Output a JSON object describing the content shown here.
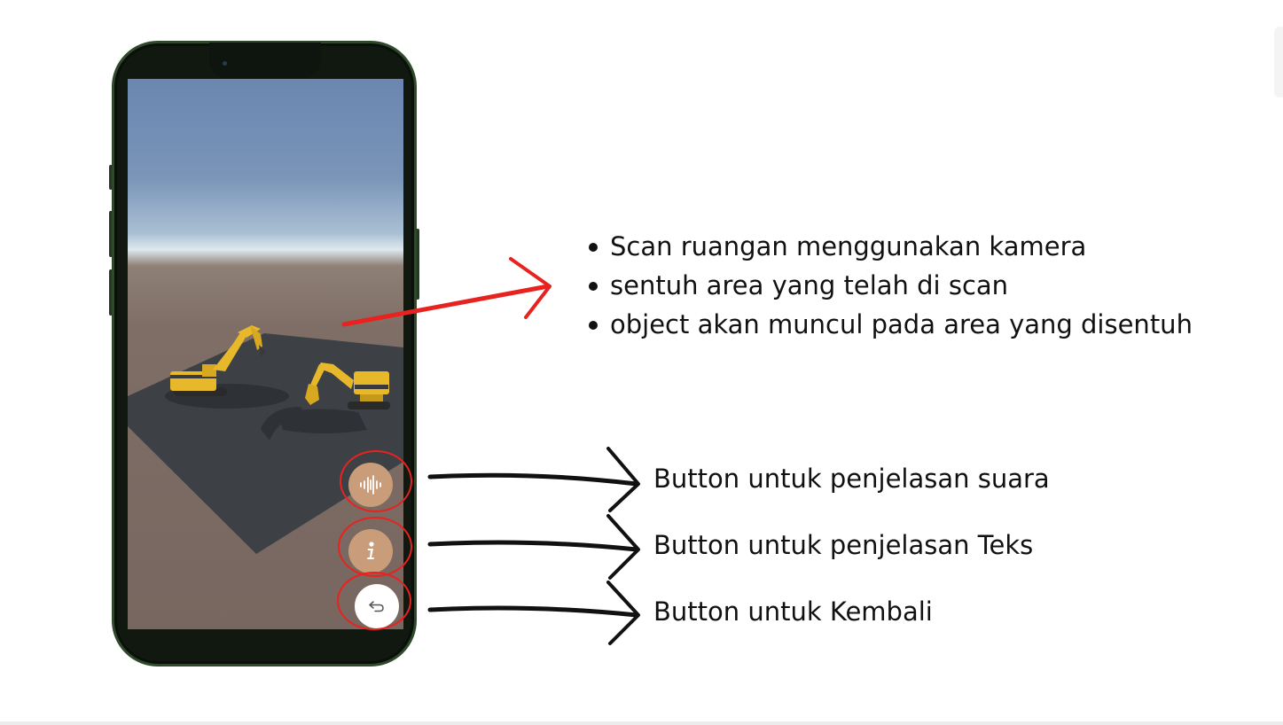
{
  "annotations": {
    "steps": [
      "Scan ruangan menggunakan kamera",
      "sentuh area yang telah di scan",
      "object akan muncul pada area yang disentuh"
    ],
    "buttons": {
      "voice_label": "Button untuk penjelasan suara",
      "text_label": "Button untuk penjelasan Teks",
      "back_label": "Button untuk Kembali"
    }
  },
  "app": {
    "scene": "AR view with two yellow excavators on a grey plane",
    "buttons": [
      {
        "icon": "sound-wave-icon",
        "color": "#c99d79"
      },
      {
        "icon": "info-icon",
        "color": "#c99d79"
      },
      {
        "icon": "back-arrow-icon",
        "color": "#ffffff"
      }
    ]
  },
  "colors": {
    "highlight": "#e8221e",
    "phone_frame": "#2e4a2a",
    "button_tan": "#c99d79"
  }
}
